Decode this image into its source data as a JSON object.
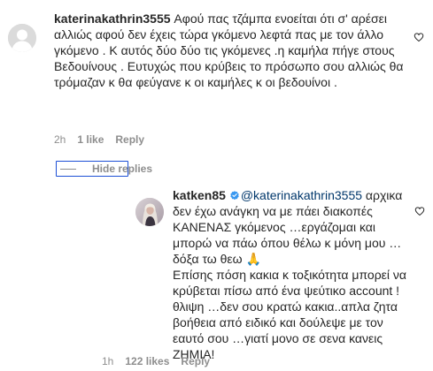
{
  "comments": [
    {
      "username": "katerinakathrin3555",
      "text": "Αφού πας τζάμπα ενοείται ότι σ' αρέσει αλλιώς αφού δεν έχεις τώρα γκόμενο λεφτά πας με τον άλλο γκόμενο . Κ αυτός δύο δύο τις γκόμενες .η καμήλα πήγε στους Βεδουίνους . Ευτυχώς που κρύβεις το πρόσωπο σου αλλιώς θα τρόμαζαν κ θα φεύγανε κ οι καμήλες κ οι βεδουίνοι .",
      "time": "2h",
      "likes": "1 like",
      "reply_label": "Reply",
      "avatar_icon": "default-user-avatar"
    }
  ],
  "hide_replies_label": "Hide replies",
  "reply": {
    "username": "katken85",
    "verified_icon": "verified-badge-icon",
    "mention": "@katerinakathrin3555",
    "text_line1": " αρχικα δεν έχω ανάγκη να με πάει διακοπές ΚΑΝΕΝΑΣ γκόμενος …εργάζομαι και μπορώ να πάω όπου θέλω κ μόνη μου …δόξα τω θεω ",
    "emoji": "🙏",
    "text_line2": "Επίσης πόση κακια κ τοξικότητα μπορεί να κρύβεται πίσω από ένα ψεύτικο account !θλιψη …δεν σου κρατώ κακια..απλα ζητα βοήθεια από ειδικό και δούλεψε με τον εαυτό σου …γιατί μονο σε σενα κανεις ΖΗΜΙΑ!",
    "time": "1h",
    "likes": "122 likes",
    "reply_label": "Reply",
    "avatar_icon": "profile-photo-avatar"
  },
  "colors": {
    "text": "#262626",
    "secondary": "#8e8e8e",
    "mention": "#00376b",
    "verified": "#3897f0",
    "focus_outline": "#1c4fd6"
  }
}
